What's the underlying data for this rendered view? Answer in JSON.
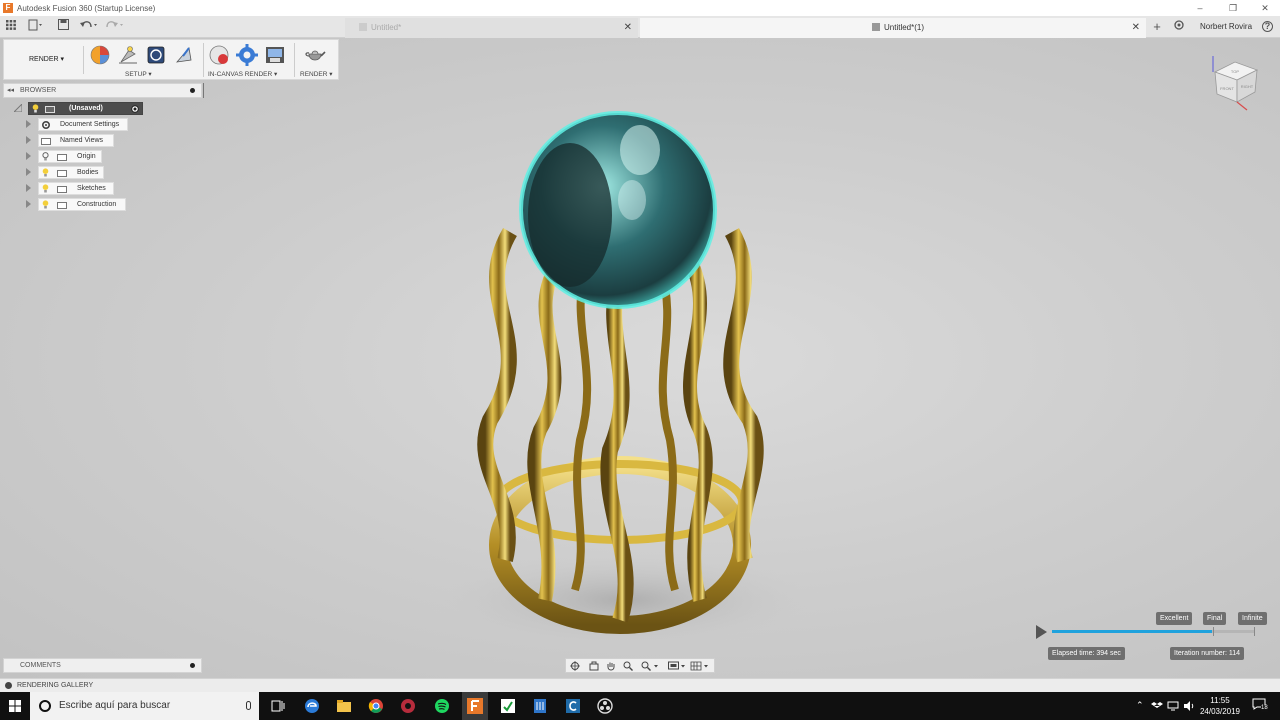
{
  "titlebar": {
    "app_logo": "F",
    "title": "Autodesk Fusion 360 (Startup License)",
    "minimize": "–",
    "restore": "❐",
    "close": "✕"
  },
  "tabs": [
    {
      "label": "Untitled*",
      "active": false
    },
    {
      "label": "Untitled*(1)",
      "active": true
    }
  ],
  "tab_close": "✕",
  "new_tab": "+",
  "user": {
    "name": "Norbert Rovira"
  },
  "help": "?",
  "toolbar": {
    "workspace": "RENDER ▾",
    "groups": [
      {
        "label": "SETUP ▾"
      },
      {
        "label": "IN-CANVAS RENDER ▾"
      },
      {
        "label": "RENDER ▾"
      }
    ]
  },
  "browser": {
    "collapse": "◂◂",
    "title": "BROWSER",
    "root": "(Unsaved)",
    "items": [
      {
        "label": "Document Settings",
        "icon": "gear-icon"
      },
      {
        "label": "Named Views",
        "icon": "folder-icon"
      },
      {
        "label": "Origin",
        "icon": "folder-icon"
      },
      {
        "label": "Bodies",
        "icon": "folder-icon"
      },
      {
        "label": "Sketches",
        "icon": "folder-icon"
      },
      {
        "label": "Construction",
        "icon": "folder-icon"
      }
    ]
  },
  "comments": {
    "title": "COMMENTS"
  },
  "gallery": {
    "title": "RENDERING GALLERY"
  },
  "render_progress": {
    "quality_labels": [
      "Excellent",
      "Final",
      "Infinite"
    ],
    "progress": 0.79,
    "elapsed": "Elapsed time: 394 sec",
    "iteration": "Iteration number: 114"
  },
  "taskbar": {
    "search_placeholder": "Escribe aquí para buscar",
    "time": "11:55",
    "date": "24/03/2019",
    "notifications": "18"
  },
  "viewcube": {
    "faces": [
      "TOP",
      "FRONT",
      "RIGHT"
    ]
  },
  "colors": {
    "accent": "#1fa2dd",
    "fusion_orange": "#e8782a",
    "gold": "#c9a227",
    "glass": "#4fd8d0"
  }
}
